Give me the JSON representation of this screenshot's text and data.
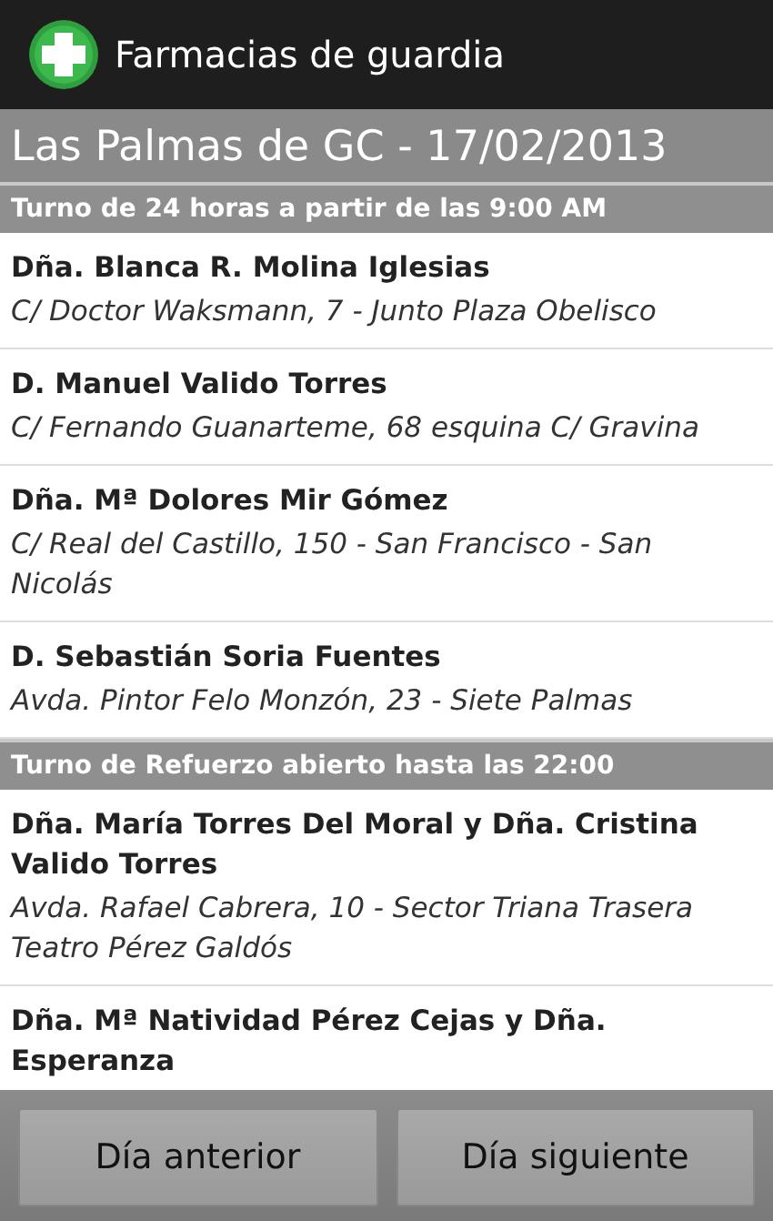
{
  "app_bar": {
    "title": "Farmacias de guardia"
  },
  "location_header": "Las Palmas de GC - 17/02/2013",
  "sections": [
    {
      "title": "Turno de 24 horas a partir de las 9:00 AM",
      "items": [
        {
          "name": "Dña. Blanca R. Molina Iglesias",
          "address": "C/ Doctor Waksmann, 7 - Junto Plaza Obelisco"
        },
        {
          "name": "D. Manuel Valido Torres",
          "address": "C/ Fernando Guanarteme, 68 esquina C/ Gravina"
        },
        {
          "name": "Dña. Mª Dolores Mir Gómez",
          "address": "C/ Real del Castillo, 150 - San Francisco - San Nicolás"
        },
        {
          "name": "D. Sebastián Soria Fuentes",
          "address": "Avda. Pintor Felo Monzón, 23 - Siete Palmas"
        }
      ]
    },
    {
      "title": "Turno de Refuerzo abierto hasta las 22:00",
      "items": [
        {
          "name": "Dña. María Torres Del Moral y Dña. Cristina Valido Torres",
          "address": "Avda. Rafael Cabrera, 10 - Sector Triana Trasera Teatro Pérez Galdós"
        },
        {
          "name": "Dña. Mª Natividad Pérez Cejas y Dña. Esperanza"
        }
      ]
    }
  ],
  "buttons": [
    "Día anterior",
    "Día siguiente"
  ]
}
